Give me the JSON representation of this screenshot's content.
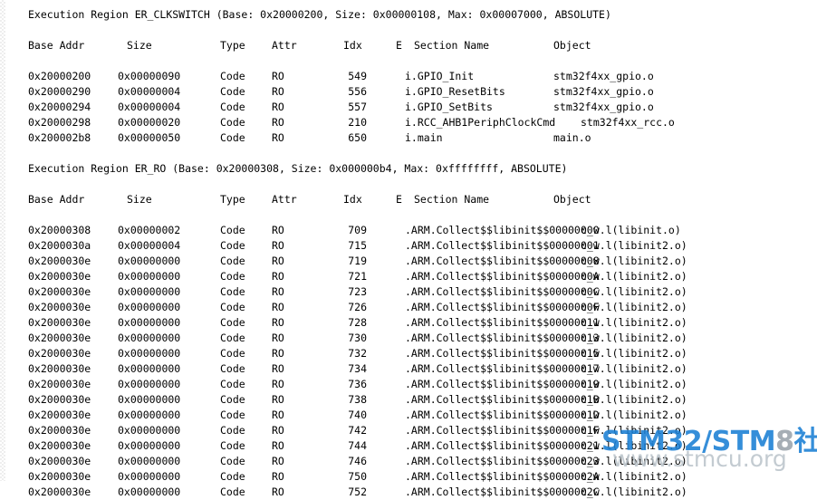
{
  "document": {
    "kind": "arm-linker-map-memory-map-listing",
    "columns": [
      "Base Addr",
      "Size",
      "Type",
      "Attr",
      "Idx",
      "E Section Name",
      "Object"
    ]
  },
  "regions": [
    {
      "title": "Execution Region ER_CLKSWITCH (Base: 0x20000200, Size: 0x00000108, Max: 0x00007000, ABSOLUTE)",
      "header": {
        "base": "Base Addr",
        "size": "Size",
        "type": "Type",
        "attr": "Attr",
        "idx": "Idx",
        "e": "E",
        "section": "Section Name",
        "object": "Object"
      },
      "rows": [
        {
          "base": "0x20000200",
          "size": "0x00000090",
          "type": "Code",
          "attr": "RO",
          "idx": "549",
          "section": "i.GPIO_Init",
          "object": "stm32f4xx_gpio.o",
          "wide": false
        },
        {
          "base": "0x20000290",
          "size": "0x00000004",
          "type": "Code",
          "attr": "RO",
          "idx": "556",
          "section": "i.GPIO_ResetBits",
          "object": "stm32f4xx_gpio.o",
          "wide": false
        },
        {
          "base": "0x20000294",
          "size": "0x00000004",
          "type": "Code",
          "attr": "RO",
          "idx": "557",
          "section": "i.GPIO_SetBits",
          "object": "stm32f4xx_gpio.o",
          "wide": false
        },
        {
          "base": "0x20000298",
          "size": "0x00000020",
          "type": "Code",
          "attr": "RO",
          "idx": "210",
          "section": "i.RCC_AHB1PeriphClockCmd",
          "object": "stm32f4xx_rcc.o",
          "wide": true
        },
        {
          "base": "0x200002b8",
          "size": "0x00000050",
          "type": "Code",
          "attr": "RO",
          "idx": "650",
          "section": "i.main",
          "object": "main.o",
          "wide": false
        }
      ]
    },
    {
      "title": "Execution Region ER_RO (Base: 0x20000308, Size: 0x000000b4, Max: 0xffffffff, ABSOLUTE)",
      "header": {
        "base": "Base Addr",
        "size": "Size",
        "type": "Type",
        "attr": "Attr",
        "idx": "Idx",
        "e": "E",
        "section": "Section Name",
        "object": "Object"
      },
      "rows": [
        {
          "base": "0x20000308",
          "size": "0x00000002",
          "type": "Code",
          "attr": "RO",
          "idx": "709",
          "section": ".ARM.Collect$$libinit$$00000000",
          "object": "c_w.l(libinit.o)",
          "wide": true
        },
        {
          "base": "0x2000030a",
          "size": "0x00000004",
          "type": "Code",
          "attr": "RO",
          "idx": "715",
          "section": ".ARM.Collect$$libinit$$00000001",
          "object": "c_w.l(libinit2.o)",
          "wide": true
        },
        {
          "base": "0x2000030e",
          "size": "0x00000000",
          "type": "Code",
          "attr": "RO",
          "idx": "719",
          "section": ".ARM.Collect$$libinit$$00000008",
          "object": "c_w.l(libinit2.o)",
          "wide": true
        },
        {
          "base": "0x2000030e",
          "size": "0x00000000",
          "type": "Code",
          "attr": "RO",
          "idx": "721",
          "section": ".ARM.Collect$$libinit$$0000000A",
          "object": "c_w.l(libinit2.o)",
          "wide": true
        },
        {
          "base": "0x2000030e",
          "size": "0x00000000",
          "type": "Code",
          "attr": "RO",
          "idx": "723",
          "section": ".ARM.Collect$$libinit$$0000000C",
          "object": "c_w.l(libinit2.o)",
          "wide": true
        },
        {
          "base": "0x2000030e",
          "size": "0x00000000",
          "type": "Code",
          "attr": "RO",
          "idx": "726",
          "section": ".ARM.Collect$$libinit$$0000000F",
          "object": "c_w.l(libinit2.o)",
          "wide": true
        },
        {
          "base": "0x2000030e",
          "size": "0x00000000",
          "type": "Code",
          "attr": "RO",
          "idx": "728",
          "section": ".ARM.Collect$$libinit$$00000011",
          "object": "c_w.l(libinit2.o)",
          "wide": true
        },
        {
          "base": "0x2000030e",
          "size": "0x00000000",
          "type": "Code",
          "attr": "RO",
          "idx": "730",
          "section": ".ARM.Collect$$libinit$$00000013",
          "object": "c_w.l(libinit2.o)",
          "wide": true
        },
        {
          "base": "0x2000030e",
          "size": "0x00000000",
          "type": "Code",
          "attr": "RO",
          "idx": "732",
          "section": ".ARM.Collect$$libinit$$00000015",
          "object": "c_w.l(libinit2.o)",
          "wide": true
        },
        {
          "base": "0x2000030e",
          "size": "0x00000000",
          "type": "Code",
          "attr": "RO",
          "idx": "734",
          "section": ".ARM.Collect$$libinit$$00000017",
          "object": "c_w.l(libinit2.o)",
          "wide": true
        },
        {
          "base": "0x2000030e",
          "size": "0x00000000",
          "type": "Code",
          "attr": "RO",
          "idx": "736",
          "section": ".ARM.Collect$$libinit$$00000019",
          "object": "c_w.l(libinit2.o)",
          "wide": true
        },
        {
          "base": "0x2000030e",
          "size": "0x00000000",
          "type": "Code",
          "attr": "RO",
          "idx": "738",
          "section": ".ARM.Collect$$libinit$$0000001B",
          "object": "c_w.l(libinit2.o)",
          "wide": true
        },
        {
          "base": "0x2000030e",
          "size": "0x00000000",
          "type": "Code",
          "attr": "RO",
          "idx": "740",
          "section": ".ARM.Collect$$libinit$$0000001D",
          "object": "c_w.l(libinit2.o)",
          "wide": true
        },
        {
          "base": "0x2000030e",
          "size": "0x00000000",
          "type": "Code",
          "attr": "RO",
          "idx": "742",
          "section": ".ARM.Collect$$libinit$$0000001F",
          "object": "c_w.l(libinit2.o)",
          "wide": true
        },
        {
          "base": "0x2000030e",
          "size": "0x00000000",
          "type": "Code",
          "attr": "RO",
          "idx": "744",
          "section": ".ARM.Collect$$libinit$$00000021",
          "object": "c_w.l(libinit2.o)",
          "wide": true
        },
        {
          "base": "0x2000030e",
          "size": "0x00000000",
          "type": "Code",
          "attr": "RO",
          "idx": "746",
          "section": ".ARM.Collect$$libinit$$00000023",
          "object": "c_w.l(libinit2.o)",
          "wide": true
        },
        {
          "base": "0x2000030e",
          "size": "0x00000000",
          "type": "Code",
          "attr": "RO",
          "idx": "750",
          "section": ".ARM.Collect$$libinit$$0000002A",
          "object": "c_w.l(libinit2.o)",
          "wide": true
        },
        {
          "base": "0x2000030e",
          "size": "0x00000000",
          "type": "Code",
          "attr": "RO",
          "idx": "752",
          "section": ".ARM.Collect$$libinit$$0000002C",
          "object": "c_w.l(libinit2.o)",
          "wide": true
        }
      ]
    }
  ],
  "watermark": {
    "brand_part1": "STM32/STM",
    "brand_part2": "8",
    "brand_part3": "社区",
    "site": "www.stmcu.org",
    "color_blue": "#1a7fd4",
    "color_gray": "#9aa3ab"
  }
}
